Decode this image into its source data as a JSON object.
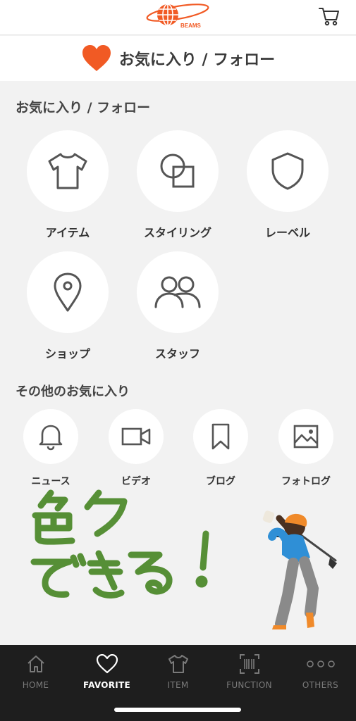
{
  "header": {
    "brand": "BEAMS",
    "icons": {
      "logo": "beams-globe-logo",
      "cart": "cart-icon"
    }
  },
  "page_title": "お気に入り / フォロー",
  "colors": {
    "accent": "#f15a24",
    "tabbar": "#1e1e1e",
    "background": "#f2f2f2"
  },
  "favorites_section": {
    "title": "お気に入り / フォロー",
    "items": [
      {
        "label": "アイテム",
        "icon": "tshirt-icon"
      },
      {
        "label": "スタイリング",
        "icon": "styling-icon"
      },
      {
        "label": "レーベル",
        "icon": "shield-icon"
      },
      {
        "label": "ショップ",
        "icon": "location-pin-icon"
      },
      {
        "label": "スタッフ",
        "icon": "people-icon"
      }
    ]
  },
  "other_section": {
    "title": "その他のお気に入り",
    "items": [
      {
        "label": "ニュース",
        "icon": "bell-icon"
      },
      {
        "label": "ビデオ",
        "icon": "video-camera-icon"
      },
      {
        "label": "ブログ",
        "icon": "bookmark-icon"
      },
      {
        "label": "フォトログ",
        "icon": "image-icon"
      }
    ]
  },
  "overlay": {
    "handwriting": "色々できる！",
    "sticker": "golfer-emoji"
  },
  "tabbar": {
    "tabs": [
      {
        "label": "HOME",
        "icon": "home-icon"
      },
      {
        "label": "FAVORITE",
        "icon": "heart-icon",
        "active": true
      },
      {
        "label": "ITEM",
        "icon": "tshirt-icon"
      },
      {
        "label": "FUNCTION",
        "icon": "barcode-scan-icon"
      },
      {
        "label": "OTHERS",
        "icon": "more-dots-icon"
      }
    ]
  }
}
